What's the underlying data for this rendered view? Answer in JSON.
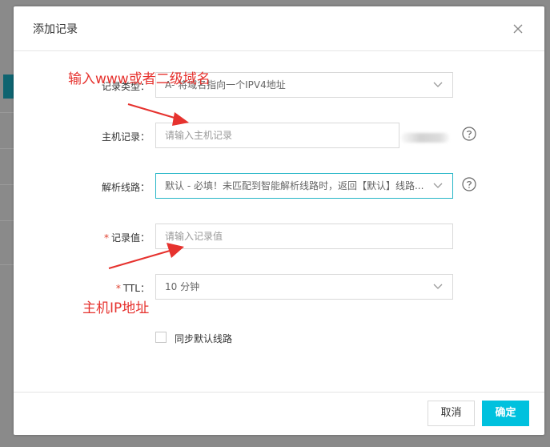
{
  "dialog": {
    "title": "添加记录",
    "close_icon": "close-icon"
  },
  "form": {
    "record_type": {
      "label": "记录类型：",
      "value": "A- 将域名指向一个IPV4地址"
    },
    "host_record": {
      "label": "主机记录：",
      "placeholder": "请输入主机记录"
    },
    "resolve_line": {
      "label": "解析线路：",
      "value": "默认 - 必填！未匹配到智能解析线路时，返回【默认】线路..."
    },
    "record_value": {
      "required_mark": "*",
      "label": "记录值：",
      "placeholder": "请输入记录值"
    },
    "ttl": {
      "required_mark": "*",
      "label": "TTL：",
      "value": "10 分钟"
    },
    "sync_default": {
      "label": "同步默认线路",
      "checked": false
    }
  },
  "buttons": {
    "cancel": "取消",
    "ok": "确定"
  },
  "annotations": {
    "top": "输入www或者二级域名",
    "bottom": "主机IP地址"
  },
  "colors": {
    "accent": "#00c1de",
    "focus_border": "#26b6c7",
    "annotation": "#e6322e",
    "required": "#e0412f"
  }
}
